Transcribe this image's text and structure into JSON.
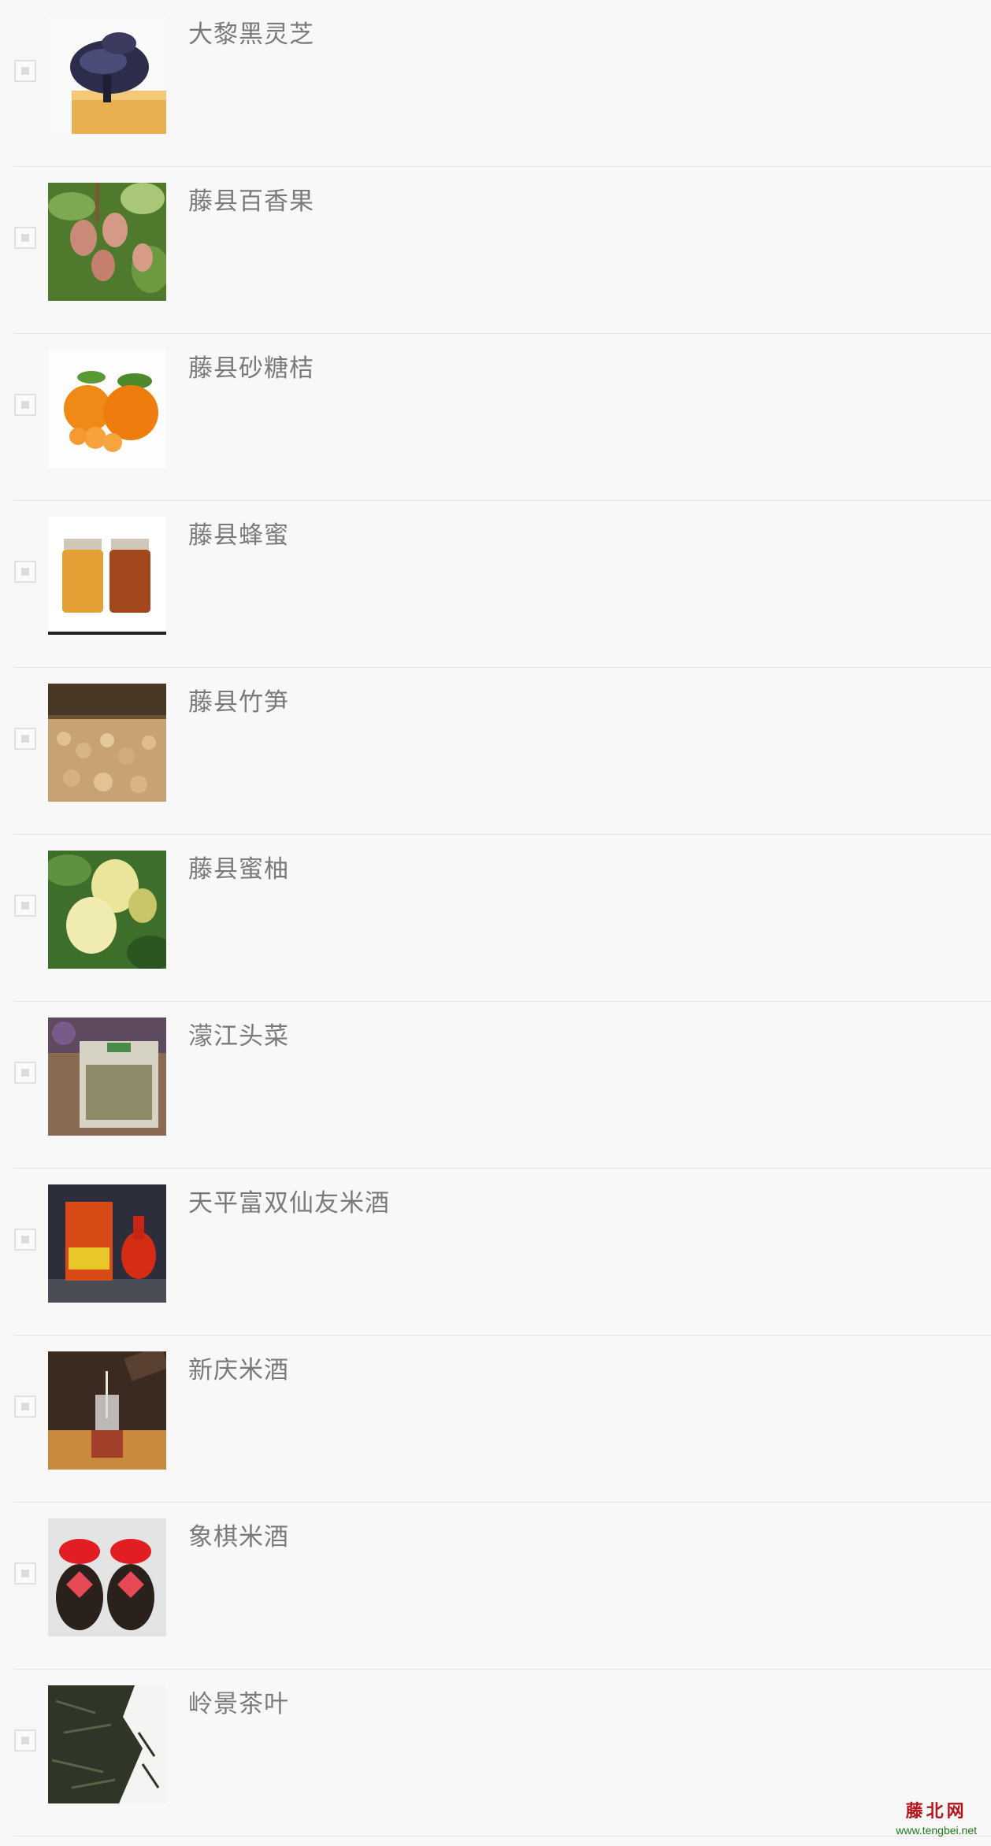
{
  "products": [
    {
      "name": "大黎黑灵芝",
      "image": "lingzhi-mushroom-image",
      "selected": false
    },
    {
      "name": "藤县百香果",
      "image": "passion-fruit-image",
      "selected": false
    },
    {
      "name": "藤县砂糖桔",
      "image": "mandarin-orange-image",
      "selected": false
    },
    {
      "name": "藤县蜂蜜",
      "image": "honey-jars-image",
      "selected": false
    },
    {
      "name": "藤县竹笋",
      "image": "bamboo-shoots-image",
      "selected": false
    },
    {
      "name": "藤县蜜柚",
      "image": "pomelo-image",
      "selected": false
    },
    {
      "name": "濛江头菜",
      "image": "preserved-vegetable-image",
      "selected": false
    },
    {
      "name": "天平富双仙友米酒",
      "image": "rice-wine-bottle-box-image",
      "selected": false
    },
    {
      "name": "新庆米酒",
      "image": "rice-wine-pour-image",
      "selected": false
    },
    {
      "name": "象棋米酒",
      "image": "rice-wine-jars-image",
      "selected": false
    },
    {
      "name": "岭景茶叶",
      "image": "tea-leaves-image",
      "selected": false
    }
  ],
  "watermark": {
    "logo": "藤北网",
    "url": "www.tengbei.net"
  }
}
